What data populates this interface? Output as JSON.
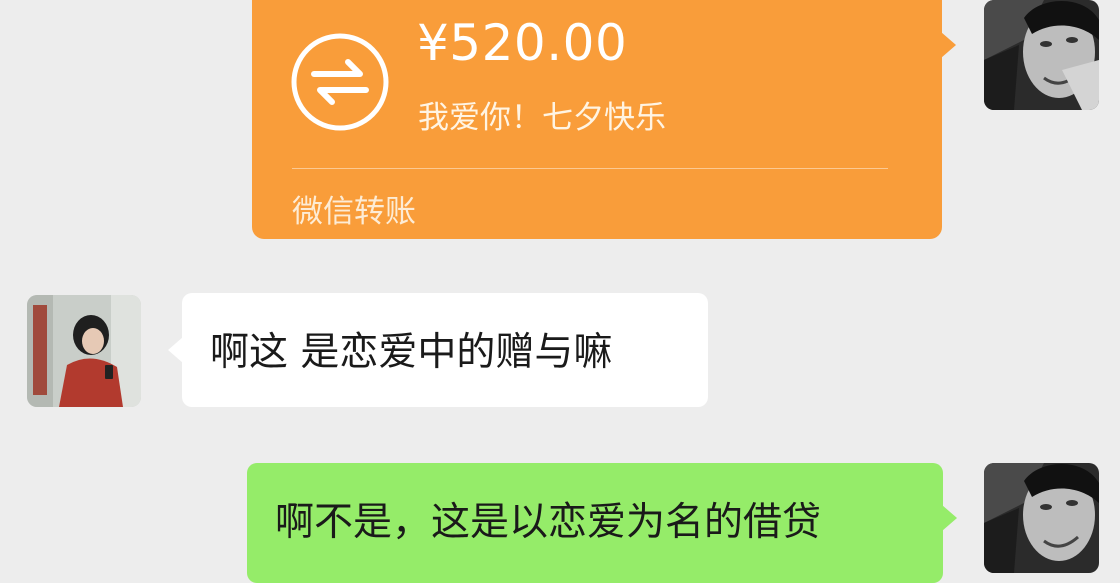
{
  "chat": {
    "transfer": {
      "amount": "¥520.00",
      "note": "我爱你！七夕快乐",
      "label": "微信转账",
      "icon": "transfer-arrows-icon",
      "card_color": "#f99d3a"
    },
    "received_message": {
      "text": "啊这 是恋爱中的赠与嘛",
      "bubble_color": "#ffffff"
    },
    "sent_message": {
      "text": "啊不是，这是以恋爱为名的借贷",
      "bubble_color": "#95ec69"
    },
    "background_color": "#ededed"
  }
}
